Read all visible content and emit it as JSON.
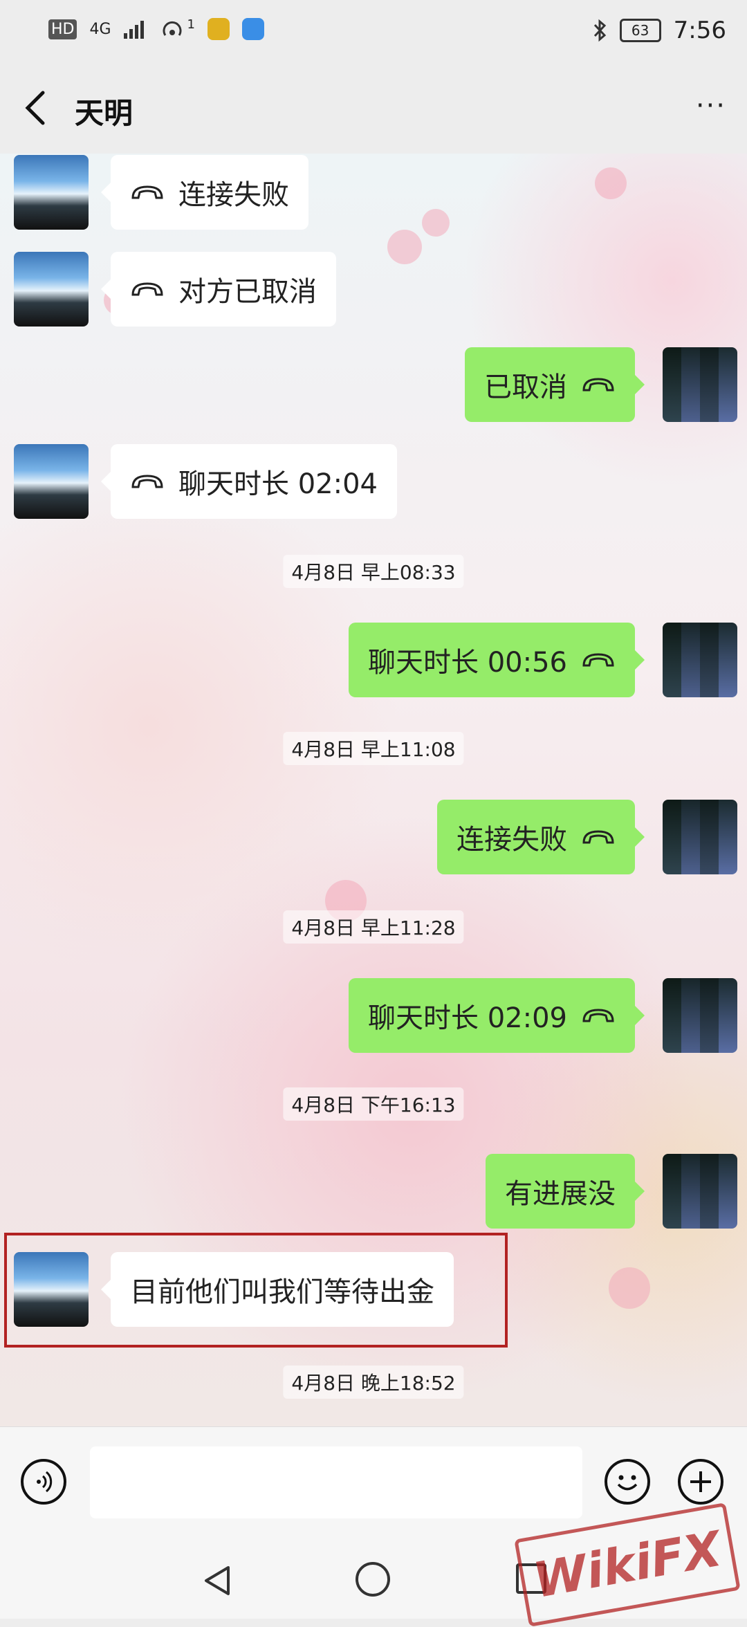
{
  "status_bar": {
    "left_text": "HD",
    "network": "4G",
    "hotspot_count": "1",
    "battery": "63",
    "time": "7:56",
    "icons": [
      "bluetooth-icon",
      "battery-icon",
      "signal-icon",
      "hotspot-icon"
    ]
  },
  "header": {
    "title": "天明",
    "more": "···"
  },
  "messages": [
    {
      "side": "left",
      "text": "连接失败",
      "icon": "call-end-icon"
    },
    {
      "side": "left",
      "text": "对方已取消",
      "icon": "call-end-icon"
    },
    {
      "side": "right",
      "text": "已取消",
      "icon": "call-end-icon"
    },
    {
      "side": "left",
      "text": "聊天时长 02:04",
      "icon": "call-end-icon"
    },
    {
      "side": "time",
      "text": "4月8日 早上08:33"
    },
    {
      "side": "right",
      "text": "聊天时长 00:56",
      "icon": "call-end-icon"
    },
    {
      "side": "time",
      "text": "4月8日 早上11:08"
    },
    {
      "side": "right",
      "text": "连接失败",
      "icon": "call-end-icon"
    },
    {
      "side": "time",
      "text": "4月8日 早上11:28"
    },
    {
      "side": "right",
      "text": "聊天时长 02:09",
      "icon": "call-end-icon"
    },
    {
      "side": "time",
      "text": "4月8日 下午16:13"
    },
    {
      "side": "right",
      "text": "有进展没"
    },
    {
      "side": "left",
      "text": "目前他们叫我们等待出金"
    },
    {
      "side": "time",
      "text": "4月8日 晚上18:52"
    }
  ],
  "colors": {
    "sent_bubble": "#95ec69",
    "received_bubble": "#ffffff",
    "highlight_box": "#b22222"
  },
  "watermark": "WikiFX"
}
